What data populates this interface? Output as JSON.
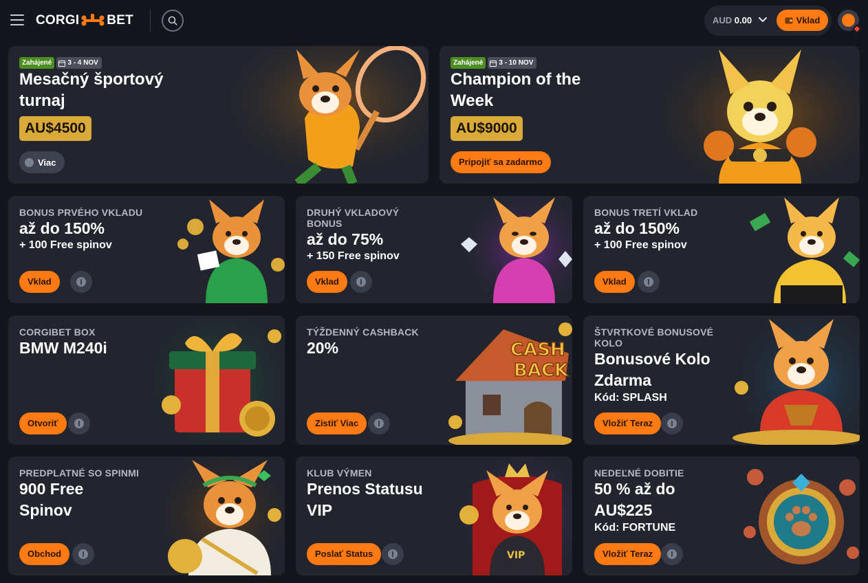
{
  "header": {
    "logo_left": "CORGI",
    "logo_right": "BET",
    "currency": "AUD",
    "balance": "0.00",
    "deposit_label": "Vklad"
  },
  "tournaments": [
    {
      "status": "Zahájené",
      "dates": "3 - 4 NOV",
      "title_line1": "Mesačný športový",
      "title_line2": "turnaj",
      "prize": "AU$4500",
      "button": "Viac"
    },
    {
      "status": "Zahájené",
      "dates": "3 - 10 NOV",
      "title_line1": "Champion of the",
      "title_line2": "Week",
      "prize": "AU$9000",
      "button": "Pripojiť sa zadarmo"
    }
  ],
  "promos": [
    {
      "eyebrow": "BONUS PRVÉHO VKLADU",
      "line1": "až do 150%",
      "line2": "+ 100 Free spinov",
      "button": "Vklad"
    },
    {
      "eyebrow_1": "DRUHÝ VKLADOVÝ",
      "eyebrow_2": "BONUS",
      "line1": "až do 75%",
      "line2": "+ 150 Free spinov",
      "button": "Vklad"
    },
    {
      "eyebrow": "BONUS TRETÍ VKLAD",
      "line1": "až do 150%",
      "line2": "+ 100 Free spinov",
      "button": "Vklad"
    },
    {
      "eyebrow": "CORGIBET BOX",
      "line1": "BMW M240i",
      "button": "Otvoriť"
    },
    {
      "eyebrow": "TÝŽDENNÝ CASHBACK",
      "line1": "20%",
      "button": "Zistiť Viac",
      "art_text_1": "CASH",
      "art_text_2": "BACK"
    },
    {
      "eyebrow_1": "ŠTVRTKOVÉ BONUSOVÉ",
      "eyebrow_2": "KOLO",
      "line1": "Bonusové Kolo",
      "line2": "Zdarma",
      "code": "Kód: SPLASH",
      "button": "Vložiť Teraz"
    },
    {
      "eyebrow": "PREDPLATNÉ SO SPINMI",
      "line1": "900 Free",
      "line2": "Spinov",
      "button": "Obchod"
    },
    {
      "eyebrow": "KLUB VÝMEN",
      "line1": "Prenos Statusu",
      "line2": "VIP",
      "button": "Poslať Status",
      "art_text": "VIP"
    },
    {
      "eyebrow": "NEDEĽNÉ DOBITIE",
      "line1": "50 % až do",
      "line2": "AU$225",
      "code": "Kód: FORTUNE",
      "button": "Vložiť Teraz"
    }
  ],
  "colors": {
    "background": "#14161d",
    "card": "#22252e",
    "accent_orange": "#ff7a12",
    "prize_gold": "#d9a93a",
    "status_green": "#4c8d1f"
  },
  "icons": [
    "menu-icon",
    "search-icon",
    "chevron-down-icon",
    "wallet-icon",
    "calendar-icon",
    "info-icon",
    "user-icon"
  ]
}
